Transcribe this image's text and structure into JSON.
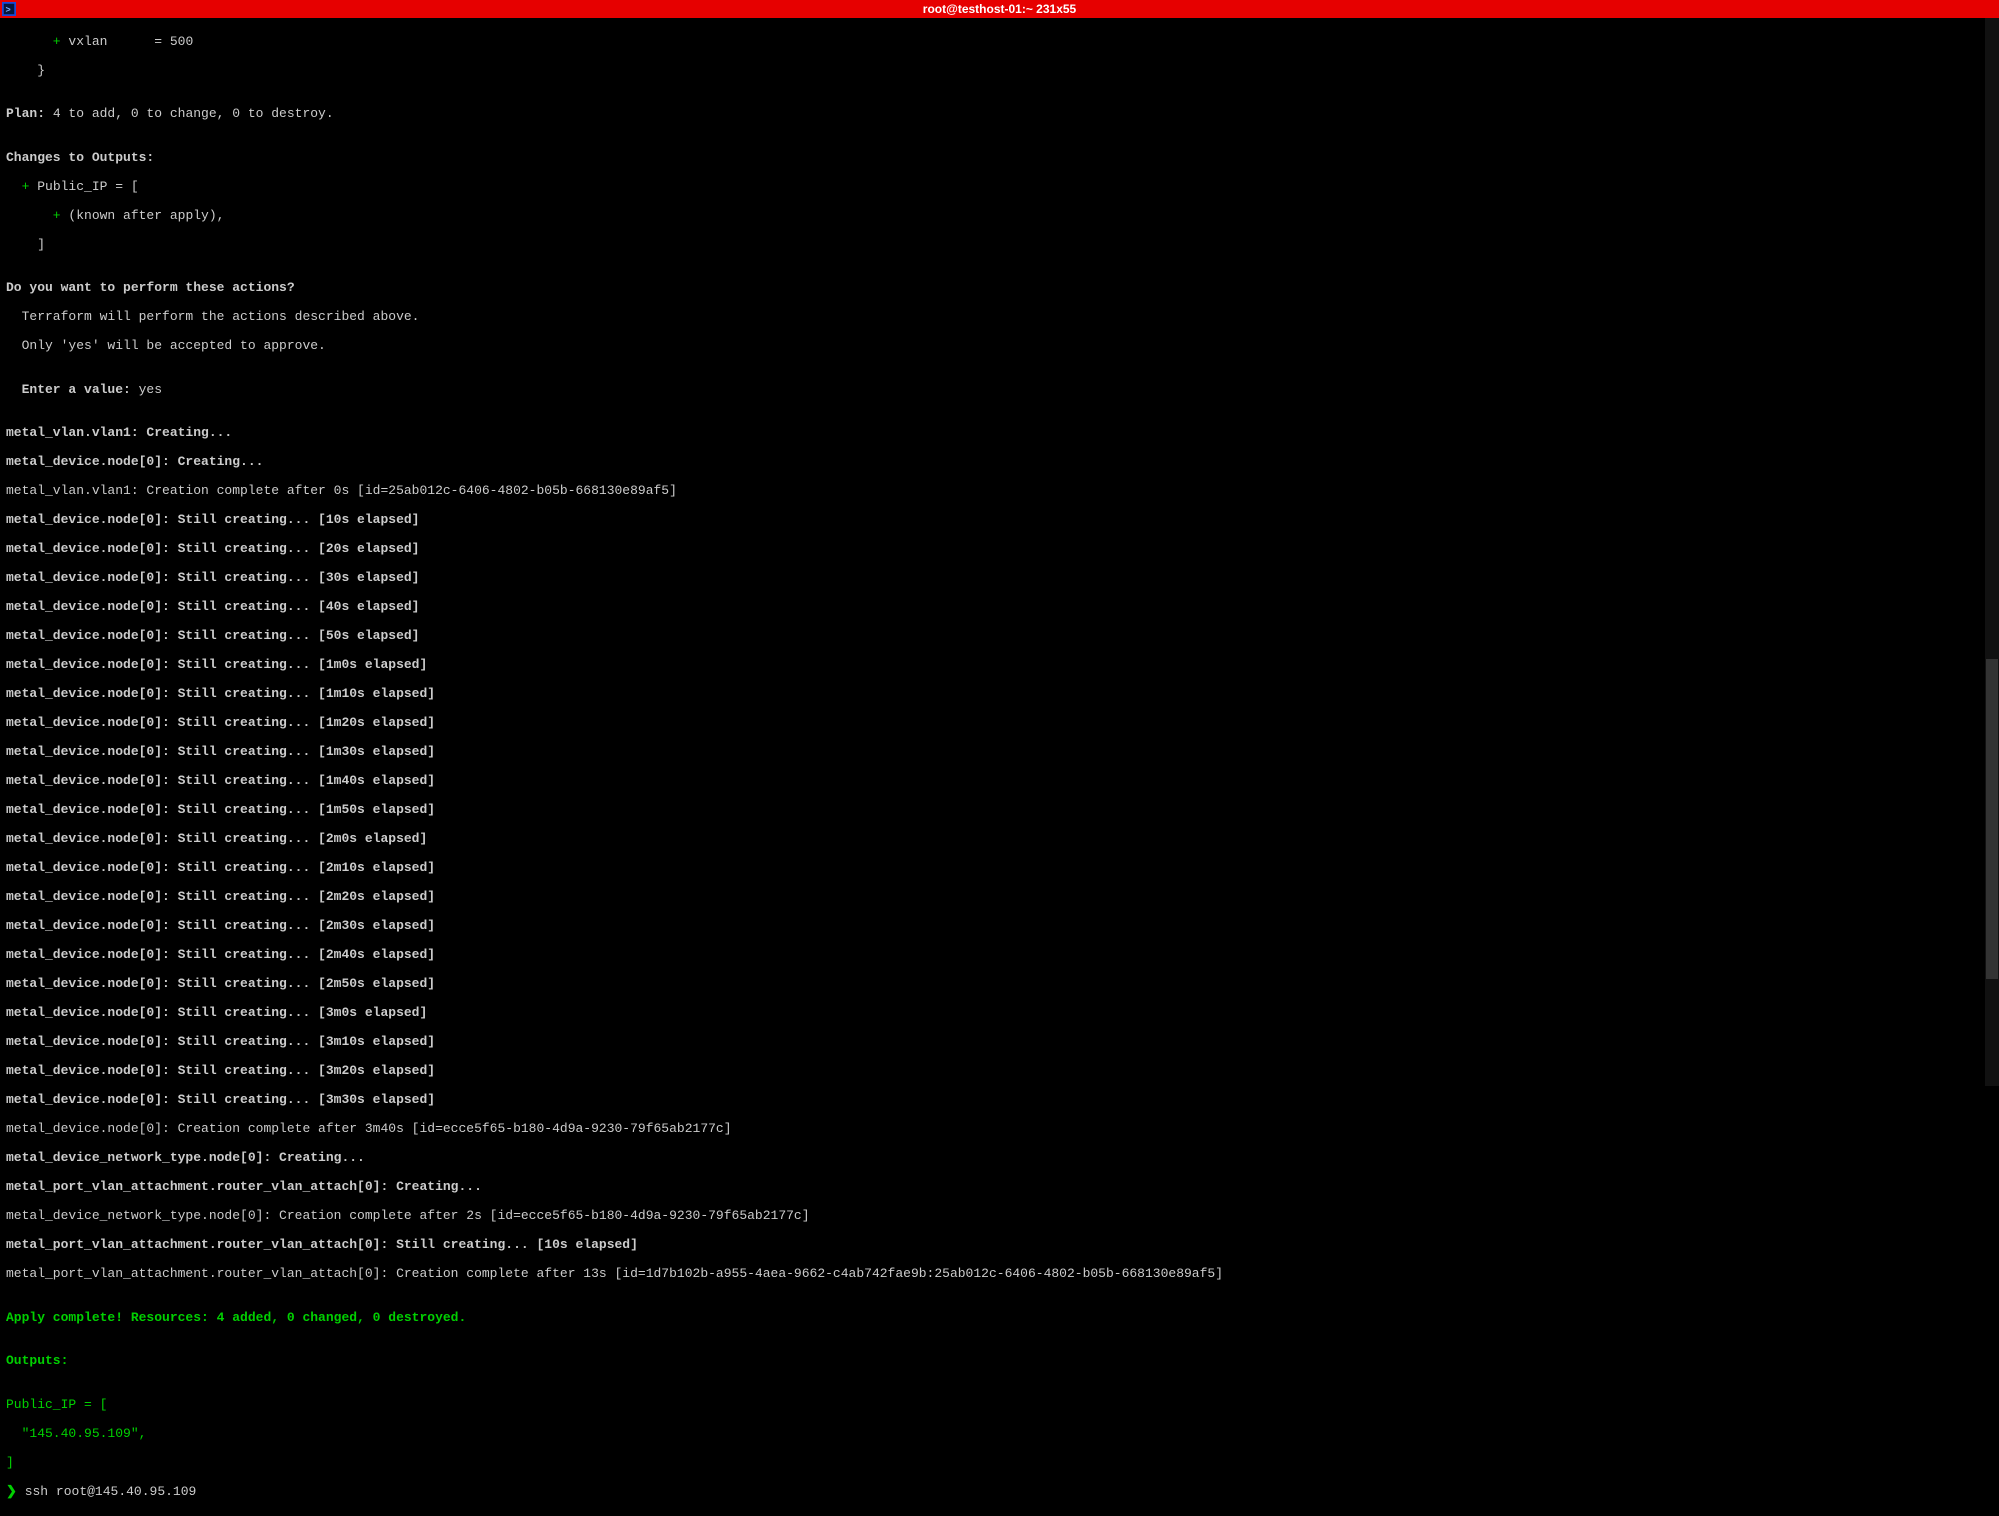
{
  "window": {
    "title": "root@testhost-01:~ 231x55"
  },
  "lines": {
    "l0_plus": "      + ",
    "l0_rest": "vxlan      = 500",
    "l1": "    }",
    "l2": "",
    "l3a": "Plan:",
    "l3b": " 4 to add, 0 to change, 0 to destroy.",
    "l4": "",
    "l5a": "Changes to Outputs:",
    "l6_plus": "  + ",
    "l6_rest": "Public_IP = [",
    "l7_plus": "      + ",
    "l7_rest": "(known after apply),",
    "l8": "    ]",
    "l9": "",
    "l10": "Do you want to perform these actions?",
    "l11": "  Terraform will perform the actions described above.",
    "l12": "  Only 'yes' will be accepted to approve.",
    "l13": "",
    "l14a": "  Enter a value:",
    "l14b": " yes",
    "l15": "",
    "l16": "metal_vlan.vlan1: Creating...",
    "l17": "metal_device.node[0]: Creating...",
    "l18": "metal_vlan.vlan1: Creation complete after 0s [id=25ab012c-6406-4802-b05b-668130e89af5]",
    "l19": "metal_device.node[0]: Still creating... [10s elapsed]",
    "l20": "metal_device.node[0]: Still creating... [20s elapsed]",
    "l21": "metal_device.node[0]: Still creating... [30s elapsed]",
    "l22": "metal_device.node[0]: Still creating... [40s elapsed]",
    "l23": "metal_device.node[0]: Still creating... [50s elapsed]",
    "l24": "metal_device.node[0]: Still creating... [1m0s elapsed]",
    "l25": "metal_device.node[0]: Still creating... [1m10s elapsed]",
    "l26": "metal_device.node[0]: Still creating... [1m20s elapsed]",
    "l27": "metal_device.node[0]: Still creating... [1m30s elapsed]",
    "l28": "metal_device.node[0]: Still creating... [1m40s elapsed]",
    "l29": "metal_device.node[0]: Still creating... [1m50s elapsed]",
    "l30": "metal_device.node[0]: Still creating... [2m0s elapsed]",
    "l31": "metal_device.node[0]: Still creating... [2m10s elapsed]",
    "l32": "metal_device.node[0]: Still creating... [2m20s elapsed]",
    "l33": "metal_device.node[0]: Still creating... [2m30s elapsed]",
    "l34": "metal_device.node[0]: Still creating... [2m40s elapsed]",
    "l35": "metal_device.node[0]: Still creating... [2m50s elapsed]",
    "l36": "metal_device.node[0]: Still creating... [3m0s elapsed]",
    "l37": "metal_device.node[0]: Still creating... [3m10s elapsed]",
    "l38": "metal_device.node[0]: Still creating... [3m20s elapsed]",
    "l39": "metal_device.node[0]: Still creating... [3m30s elapsed]",
    "l40": "metal_device.node[0]: Creation complete after 3m40s [id=ecce5f65-b180-4d9a-9230-79f65ab2177c]",
    "l41": "metal_device_network_type.node[0]: Creating...",
    "l42": "metal_port_vlan_attachment.router_vlan_attach[0]: Creating...",
    "l43": "metal_device_network_type.node[0]: Creation complete after 2s [id=ecce5f65-b180-4d9a-9230-79f65ab2177c]",
    "l44": "metal_port_vlan_attachment.router_vlan_attach[0]: Still creating... [10s elapsed]",
    "l45": "metal_port_vlan_attachment.router_vlan_attach[0]: Creation complete after 13s [id=1d7b102b-a955-4aea-9662-c4ab742fae9b:25ab012c-6406-4802-b05b-668130e89af5]",
    "l46": "",
    "l47": "Apply complete! Resources: 4 added, 0 changed, 0 destroyed.",
    "l48": "",
    "l49": "Outputs:",
    "l50": "",
    "l51": "Public_IP = [",
    "l52": "  \"145.40.95.109\",",
    "l53": "]",
    "l54a": "❯",
    "l54b": " ssh root@145.40.95.109"
  }
}
